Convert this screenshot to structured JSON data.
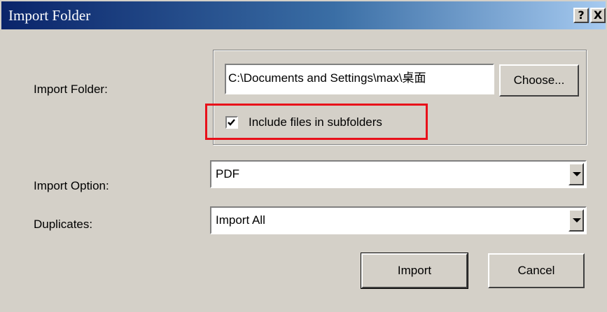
{
  "window": {
    "title": "Import Folder",
    "help_label": "?",
    "close_label": "X"
  },
  "import_folder": {
    "label": "Import Folder:",
    "path_value": "C:\\Documents and Settings\\max\\桌面",
    "choose_label": "Choose...",
    "include_subfolders_label": "Include files in subfolders",
    "include_subfolders_checked": true
  },
  "import_option": {
    "label": "Import Option:",
    "selected": "PDF"
  },
  "duplicates": {
    "label": "Duplicates:",
    "selected": "Import All"
  },
  "actions": {
    "import_label": "Import",
    "cancel_label": "Cancel"
  },
  "colors": {
    "highlight_box": "#e8101a",
    "dialog_bg": "#d4d0c8",
    "titlebar_start": "#0a246a",
    "titlebar_end": "#a6caf0"
  }
}
